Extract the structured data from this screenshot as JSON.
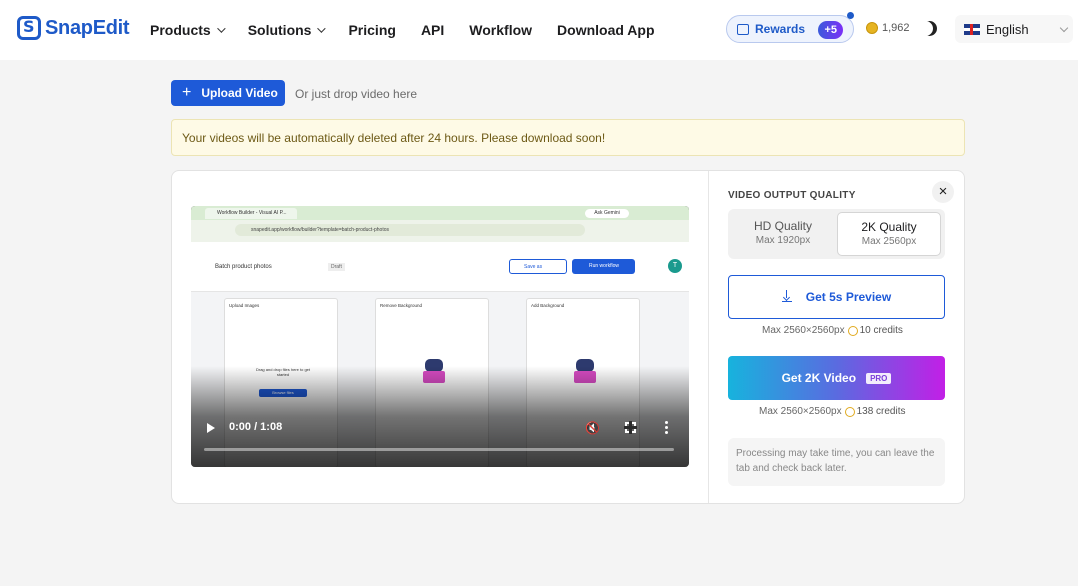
{
  "header": {
    "brand": "SnapEdit",
    "nav": [
      {
        "label": "Products",
        "has_menu": true
      },
      {
        "label": "Solutions",
        "has_menu": true
      },
      {
        "label": "Pricing",
        "has_menu": false
      },
      {
        "label": "API",
        "has_menu": false
      },
      {
        "label": "Workflow",
        "has_menu": false
      },
      {
        "label": "Download App",
        "has_menu": false
      }
    ],
    "rewards_label": "Rewards",
    "rewards_bonus": "+5",
    "credits": "1,962",
    "language": "English"
  },
  "upload": {
    "button_label": "Upload Video",
    "hint": "Or just drop video here"
  },
  "notice": "Your videos will be automatically deleted after 24 hours. Please download soon!",
  "player": {
    "time": "0:00 / 1:08",
    "progress_fraction": 0,
    "frame": {
      "tab_title": "Workflow Builder - Visual AI P...",
      "gemini_label": "Ask Gemini",
      "url": "snapedit.app/workflow/builder?template=batch-product-photos",
      "workflow_title": "Batch product photos",
      "draft_label": "Draft",
      "save_as_label": "Save as",
      "run_label": "Run workflow",
      "avatar": "T",
      "node_titles": [
        "Upload Images",
        "Remove Background",
        "Add Background"
      ],
      "upload_text": "Drag and drop files here to get started",
      "browse_label": "Browse files"
    }
  },
  "panel": {
    "title": "VIDEO OUTPUT QUALITY",
    "qualities": [
      {
        "name": "HD Quality",
        "max": "Max 1920px",
        "selected": false
      },
      {
        "name": "2K Quality",
        "max": "Max 2560px",
        "selected": true
      }
    ],
    "preview_label": "Get 5s Preview",
    "preview_res": "Max 2560×2560px",
    "preview_credits": "10 credits",
    "video_label": "Get 2K Video",
    "pro_badge": "PRO",
    "video_res": "Max 2560×2560px",
    "video_credits": "138 credits",
    "processing_note": "Processing may take time, you can leave the tab and check back later."
  },
  "colors": {
    "brand": "#1e5ac8",
    "primary_button": "#1e5ad8",
    "notice_bg": "#fefae6",
    "video_gradient": [
      "#17b3dd",
      "#5a6be0",
      "#c21fe6"
    ]
  },
  "icons": [
    "plus-icon",
    "gift-icon",
    "coin-icon",
    "moon-icon",
    "uk-flag-icon",
    "chevron-down-icon",
    "close-icon",
    "download-icon",
    "play-icon",
    "mute-icon",
    "fullscreen-icon",
    "more-vertical-icon"
  ]
}
